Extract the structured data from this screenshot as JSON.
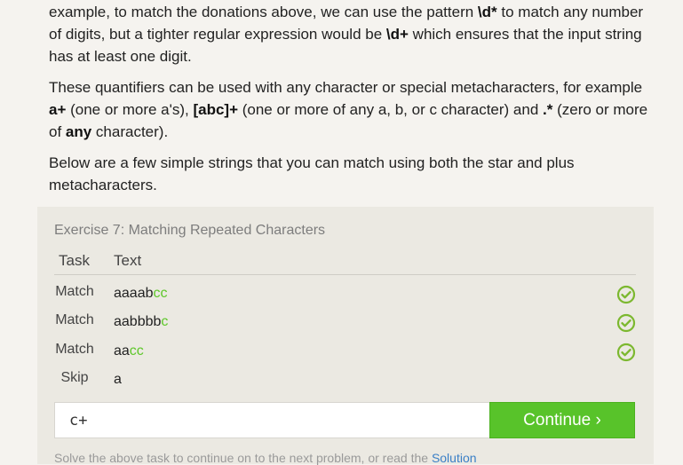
{
  "lesson": {
    "p1": {
      "a": "example, to match the donations above, we can use the pattern ",
      "b": "\\d*",
      "c": " to match any number of digits, but a tighter regular expression would be ",
      "d": "\\d+",
      "e": " which ensures that the input string has at least one digit."
    },
    "p2": {
      "a": "These quantifiers can be used with any character or special metacharacters, for example ",
      "b": "a+",
      "c": " (one or more a's), ",
      "d": "[abc]+",
      "e": " (one or more of any a, b, or c character) and ",
      "f": ".*",
      "g": " (zero or more of ",
      "h": "any",
      "i": " character)."
    },
    "p3": "Below are a few simple strings that you can match using both the star and plus metacharacters."
  },
  "exercise": {
    "title": "Exercise 7: Matching Repeated Characters",
    "col_task": "Task",
    "col_text": "Text",
    "rows": [
      {
        "task": "Match",
        "plain": "aaaab",
        "highlight": "cc",
        "status": "matched"
      },
      {
        "task": "Match",
        "plain": "aabbbb",
        "highlight": "c",
        "status": "matched"
      },
      {
        "task": "Match",
        "plain": "aa",
        "highlight": "cc",
        "status": "matched"
      },
      {
        "task": "Skip",
        "plain": "a",
        "highlight": "",
        "status": "none"
      }
    ],
    "answer_value": "c+",
    "continue_label": "Continue ›",
    "footnote_text": "Solve the above task to continue on to the next problem, or read the ",
    "footnote_link": "Solution"
  },
  "colors": {
    "accent_green": "#58c32a",
    "highlight_green": "#5ec72a",
    "check_green": "#7cb82f"
  },
  "icons": {
    "check": "check-circle-icon"
  }
}
